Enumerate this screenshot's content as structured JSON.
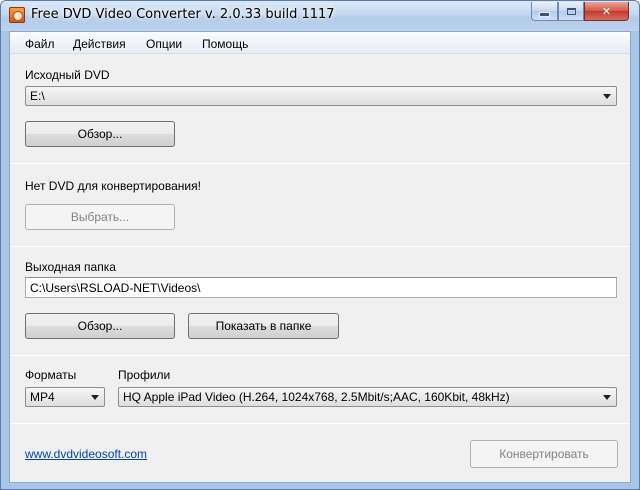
{
  "window": {
    "title": "Free DVD Video Converter  v. 2.0.33 build 1117"
  },
  "menu": {
    "items": [
      "Файл",
      "Действия",
      "Опции",
      "Помощь"
    ]
  },
  "source": {
    "label": "Исходный DVD",
    "drive_value": "E:\\",
    "browse_label": "Обзор..."
  },
  "dvd_status": {
    "message": "Нет DVD для конвертирования!",
    "select_label": "Выбрать..."
  },
  "output": {
    "label": "Выходная папка",
    "path_value": "C:\\Users\\RSLOAD-NET\\Videos\\",
    "browse_label": "Обзор...",
    "show_folder_label": "Показать в папке"
  },
  "formats": {
    "label": "Форматы",
    "selected": "MP4"
  },
  "profiles": {
    "label": "Профили",
    "selected": "HQ Apple iPad Video (H.264, 1024x768, 2.5Mbit/s;AAC, 160Kbit, 48kHz)"
  },
  "footer": {
    "link_text": "www.dvdvideosoft.com",
    "convert_label": "Конвертировать"
  },
  "colors": {
    "link": "#0645ad",
    "frame": "#a9c6e8",
    "close_button": "#c13a2c"
  }
}
